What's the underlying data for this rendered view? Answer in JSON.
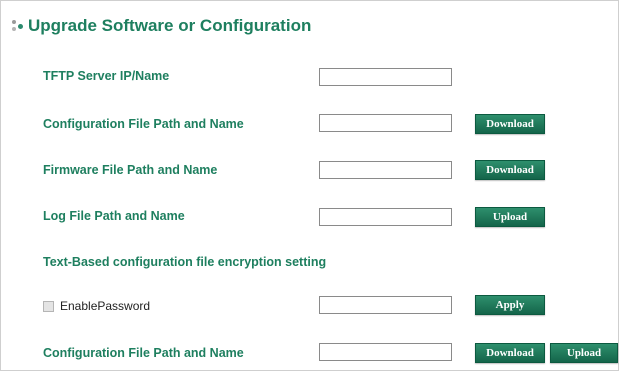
{
  "page": {
    "title": "Upgrade Software or Configuration"
  },
  "rows": {
    "tftp_label": "TFTP Server IP/Name",
    "tftp_value": "",
    "config_label": "Configuration File Path and Name",
    "config_value": "",
    "config_button": "Download",
    "firmware_label": "Firmware File Path and Name",
    "firmware_value": "",
    "firmware_button": "Download",
    "log_label": "Log File Path and Name",
    "log_value": "",
    "log_button": "Upload",
    "encryption_heading": "Text-Based configuration file encryption setting",
    "enable_password_label": "EnablePassword",
    "enable_password_checked": false,
    "password_value": "",
    "apply_button": "Apply",
    "config2_label": "Configuration File Path and Name",
    "config2_value": "",
    "config2_download_button": "Download",
    "config2_upload_button": "Upload"
  },
  "colors": {
    "heading_green": "#1e7f5f",
    "button_green": "#14654a"
  }
}
